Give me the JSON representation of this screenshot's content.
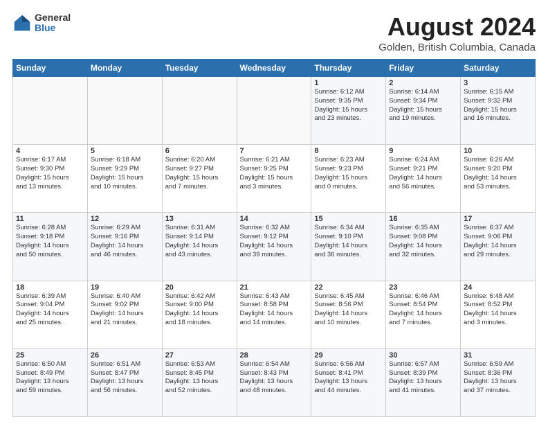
{
  "header": {
    "logo": {
      "general": "General",
      "blue": "Blue"
    },
    "title": "August 2024",
    "location": "Golden, British Columbia, Canada"
  },
  "calendar": {
    "weekdays": [
      "Sunday",
      "Monday",
      "Tuesday",
      "Wednesday",
      "Thursday",
      "Friday",
      "Saturday"
    ],
    "weeks": [
      [
        {
          "day": "",
          "info": ""
        },
        {
          "day": "",
          "info": ""
        },
        {
          "day": "",
          "info": ""
        },
        {
          "day": "",
          "info": ""
        },
        {
          "day": "1",
          "info": "Sunrise: 6:12 AM\nSunset: 9:35 PM\nDaylight: 15 hours\nand 23 minutes."
        },
        {
          "day": "2",
          "info": "Sunrise: 6:14 AM\nSunset: 9:34 PM\nDaylight: 15 hours\nand 19 minutes."
        },
        {
          "day": "3",
          "info": "Sunrise: 6:15 AM\nSunset: 9:32 PM\nDaylight: 15 hours\nand 16 minutes."
        }
      ],
      [
        {
          "day": "4",
          "info": "Sunrise: 6:17 AM\nSunset: 9:30 PM\nDaylight: 15 hours\nand 13 minutes."
        },
        {
          "day": "5",
          "info": "Sunrise: 6:18 AM\nSunset: 9:29 PM\nDaylight: 15 hours\nand 10 minutes."
        },
        {
          "day": "6",
          "info": "Sunrise: 6:20 AM\nSunset: 9:27 PM\nDaylight: 15 hours\nand 7 minutes."
        },
        {
          "day": "7",
          "info": "Sunrise: 6:21 AM\nSunset: 9:25 PM\nDaylight: 15 hours\nand 3 minutes."
        },
        {
          "day": "8",
          "info": "Sunrise: 6:23 AM\nSunset: 9:23 PM\nDaylight: 15 hours\nand 0 minutes."
        },
        {
          "day": "9",
          "info": "Sunrise: 6:24 AM\nSunset: 9:21 PM\nDaylight: 14 hours\nand 56 minutes."
        },
        {
          "day": "10",
          "info": "Sunrise: 6:26 AM\nSunset: 9:20 PM\nDaylight: 14 hours\nand 53 minutes."
        }
      ],
      [
        {
          "day": "11",
          "info": "Sunrise: 6:28 AM\nSunset: 9:18 PM\nDaylight: 14 hours\nand 50 minutes."
        },
        {
          "day": "12",
          "info": "Sunrise: 6:29 AM\nSunset: 9:16 PM\nDaylight: 14 hours\nand 46 minutes."
        },
        {
          "day": "13",
          "info": "Sunrise: 6:31 AM\nSunset: 9:14 PM\nDaylight: 14 hours\nand 43 minutes."
        },
        {
          "day": "14",
          "info": "Sunrise: 6:32 AM\nSunset: 9:12 PM\nDaylight: 14 hours\nand 39 minutes."
        },
        {
          "day": "15",
          "info": "Sunrise: 6:34 AM\nSunset: 9:10 PM\nDaylight: 14 hours\nand 36 minutes."
        },
        {
          "day": "16",
          "info": "Sunrise: 6:35 AM\nSunset: 9:08 PM\nDaylight: 14 hours\nand 32 minutes."
        },
        {
          "day": "17",
          "info": "Sunrise: 6:37 AM\nSunset: 9:06 PM\nDaylight: 14 hours\nand 29 minutes."
        }
      ],
      [
        {
          "day": "18",
          "info": "Sunrise: 6:39 AM\nSunset: 9:04 PM\nDaylight: 14 hours\nand 25 minutes."
        },
        {
          "day": "19",
          "info": "Sunrise: 6:40 AM\nSunset: 9:02 PM\nDaylight: 14 hours\nand 21 minutes."
        },
        {
          "day": "20",
          "info": "Sunrise: 6:42 AM\nSunset: 9:00 PM\nDaylight: 14 hours\nand 18 minutes."
        },
        {
          "day": "21",
          "info": "Sunrise: 6:43 AM\nSunset: 8:58 PM\nDaylight: 14 hours\nand 14 minutes."
        },
        {
          "day": "22",
          "info": "Sunrise: 6:45 AM\nSunset: 8:56 PM\nDaylight: 14 hours\nand 10 minutes."
        },
        {
          "day": "23",
          "info": "Sunrise: 6:46 AM\nSunset: 8:54 PM\nDaylight: 14 hours\nand 7 minutes."
        },
        {
          "day": "24",
          "info": "Sunrise: 6:48 AM\nSunset: 8:52 PM\nDaylight: 14 hours\nand 3 minutes."
        }
      ],
      [
        {
          "day": "25",
          "info": "Sunrise: 6:50 AM\nSunset: 8:49 PM\nDaylight: 13 hours\nand 59 minutes."
        },
        {
          "day": "26",
          "info": "Sunrise: 6:51 AM\nSunset: 8:47 PM\nDaylight: 13 hours\nand 56 minutes."
        },
        {
          "day": "27",
          "info": "Sunrise: 6:53 AM\nSunset: 8:45 PM\nDaylight: 13 hours\nand 52 minutes."
        },
        {
          "day": "28",
          "info": "Sunrise: 6:54 AM\nSunset: 8:43 PM\nDaylight: 13 hours\nand 48 minutes."
        },
        {
          "day": "29",
          "info": "Sunrise: 6:56 AM\nSunset: 8:41 PM\nDaylight: 13 hours\nand 44 minutes."
        },
        {
          "day": "30",
          "info": "Sunrise: 6:57 AM\nSunset: 8:39 PM\nDaylight: 13 hours\nand 41 minutes."
        },
        {
          "day": "31",
          "info": "Sunrise: 6:59 AM\nSunset: 8:36 PM\nDaylight: 13 hours\nand 37 minutes."
        }
      ]
    ]
  }
}
